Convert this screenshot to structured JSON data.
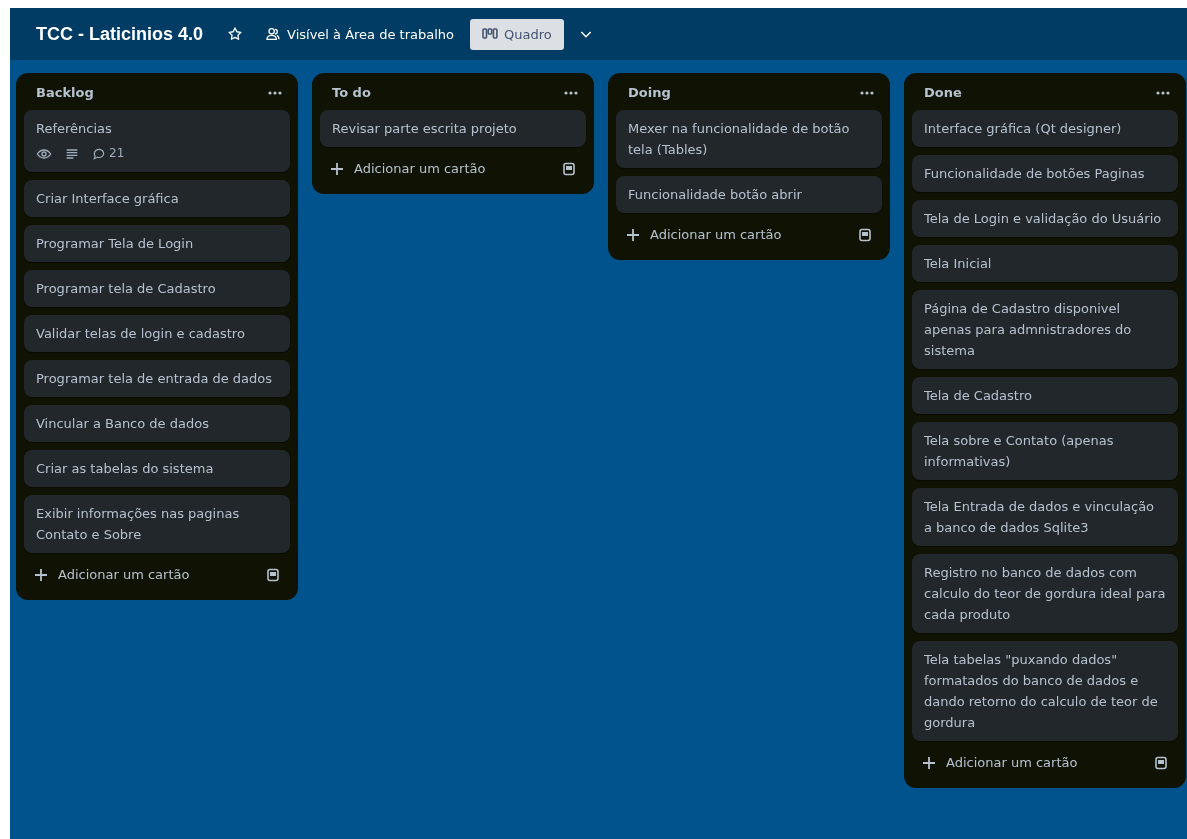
{
  "board": {
    "title": "TCC - Laticinios 4.0",
    "starred": false,
    "visibility": "Visível à Área de trabalho",
    "view": "Quadro"
  },
  "lists": [
    {
      "title": "Backlog",
      "cards": [
        {
          "title": "Referências",
          "watching": true,
          "description": true,
          "comments": "21"
        },
        {
          "title": "Criar Interface gráfica"
        },
        {
          "title": "Programar Tela de Login"
        },
        {
          "title": "Programar tela de Cadastro"
        },
        {
          "title": "Validar telas de login e cadastro"
        },
        {
          "title": "Programar tela de entrada de dados"
        },
        {
          "title": "Vincular a Banco de dados"
        },
        {
          "title": "Criar as tabelas do sistema"
        },
        {
          "title": "Exibir informações nas paginas Contato e Sobre"
        }
      ],
      "add": "Adicionar um cartão"
    },
    {
      "title": "To do",
      "cards": [
        {
          "title": "Revisar parte escrita projeto"
        }
      ],
      "add": "Adicionar um cartão"
    },
    {
      "title": "Doing",
      "cards": [
        {
          "title": "Mexer na funcionalidade de botão tela (Tables)"
        },
        {
          "title": "Funcionalidade botão abrir"
        }
      ],
      "add": "Adicionar um cartão"
    },
    {
      "title": "Done",
      "cards": [
        {
          "title": "Interface gráfica (Qt designer)"
        },
        {
          "title": "Funcionalidade de botões Paginas"
        },
        {
          "title": "Tela de Login e validação do Usuário"
        },
        {
          "title": "Tela Inicial"
        },
        {
          "title": "Página de Cadastro disponivel apenas para admnistradores do sistema"
        },
        {
          "title": "Tela de Cadastro"
        },
        {
          "title": "Tela sobre e Contato (apenas informativas)"
        },
        {
          "title": "Tela Entrada de dados e vinculação a banco de dados Sqlite3"
        },
        {
          "title": "Registro no banco de dados com calculo do teor de gordura ideal para cada produto"
        },
        {
          "title": "Tela tabelas \"puxando dados\" formatados do banco de dados e dando retorno do calculo de teor de gordura"
        }
      ],
      "add": "Adicionar um cartão"
    }
  ]
}
